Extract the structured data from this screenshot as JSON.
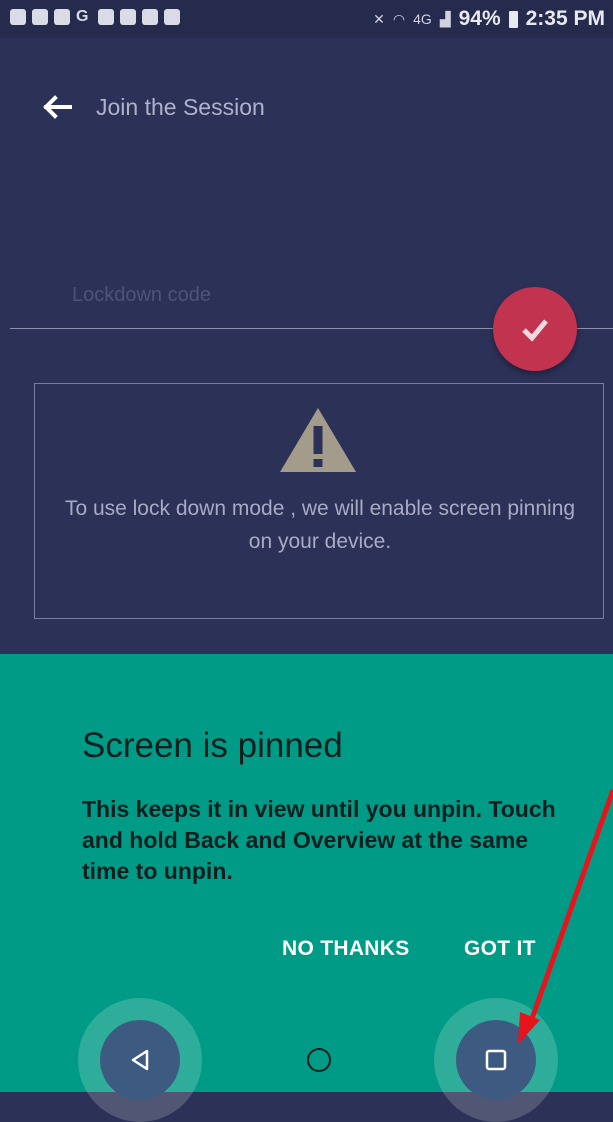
{
  "status_bar": {
    "battery": "94%",
    "time": "2:35 PM",
    "network": "4G",
    "notification_icons": [
      "message-icon",
      "image-icon",
      "shield-icon",
      "google-icon",
      "cast-icon",
      "missed-call-icon",
      "camera-icon",
      "photo-icon"
    ]
  },
  "header": {
    "title": "Join the Session"
  },
  "code_input": {
    "placeholder": "Lockdown code"
  },
  "info": {
    "message": "To use lock down mode , we will enable screen pinning on your device."
  },
  "pin_dialog": {
    "title": "Screen is pinned",
    "body": "This keeps it in view until you unpin. Touch and hold Back and Overview at the same time to unpin.",
    "no_thanks": "NO THANKS",
    "got_it": "GOT IT"
  },
  "colors": {
    "background": "#2c3157",
    "accent_button": "#c1334f",
    "pin_panel": "#009b86",
    "annotation_arrow": "#e8141b"
  }
}
